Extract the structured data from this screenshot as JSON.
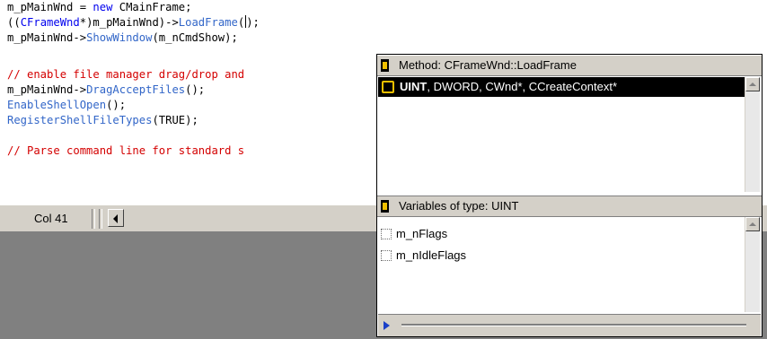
{
  "editor": {
    "lines": [
      {
        "parts": [
          {
            "t": "m_pMainWnd = ",
            "c": "plain"
          },
          {
            "t": "new",
            "c": "kw"
          },
          {
            "t": " CMainFrame;",
            "c": "plain"
          }
        ]
      },
      {
        "parts": [
          {
            "t": "((",
            "c": "plain"
          },
          {
            "t": "CFrameWnd",
            "c": "kw"
          },
          {
            "t": "*)m_pMainWnd)->",
            "c": "plain"
          },
          {
            "t": "LoadFrame",
            "c": "fn"
          },
          {
            "t": "(",
            "c": "plain"
          },
          {
            "t": "CARET",
            "c": "caret"
          },
          {
            "t": ");",
            "c": "plain"
          }
        ]
      },
      {
        "parts": [
          {
            "t": "m_pMainWnd->",
            "c": "plain"
          },
          {
            "t": "ShowWindow",
            "c": "fn"
          },
          {
            "t": "(m_nCmdShow);",
            "c": "plain"
          }
        ]
      },
      {
        "parts": [
          {
            "t": "",
            "c": "plain"
          }
        ]
      },
      {
        "parts": [
          {
            "t": "// enable file manager drag/drop and",
            "c": "cm"
          }
        ]
      },
      {
        "parts": [
          {
            "t": "m_pMainWnd->",
            "c": "plain"
          },
          {
            "t": "DragAcceptFiles",
            "c": "fn"
          },
          {
            "t": "();",
            "c": "plain"
          }
        ]
      },
      {
        "parts": [
          {
            "t": "EnableShellOpen",
            "c": "fn"
          },
          {
            "t": "();",
            "c": "plain"
          }
        ]
      },
      {
        "parts": [
          {
            "t": "RegisterShellFileTypes",
            "c": "fn"
          },
          {
            "t": "(TRUE);",
            "c": "plain"
          }
        ]
      },
      {
        "parts": [
          {
            "t": "",
            "c": "plain"
          }
        ]
      },
      {
        "parts": [
          {
            "t": "// Parse command line for standard s",
            "c": "cm"
          }
        ]
      }
    ]
  },
  "statusbar": {
    "col": "Col 41"
  },
  "popup": {
    "method_title": "Method: CFrameWnd::LoadFrame",
    "signature_bold": "UINT",
    "signature_rest": ", DWORD, CWnd*, CCreateContext*",
    "variables_title": "Variables of type: UINT",
    "variables": [
      "m_nFlags",
      "m_nIdleFlags"
    ]
  },
  "colors": {
    "keyword": "#0000ee",
    "function": "#3266c8",
    "comment": "#d40000",
    "selection": "#000000",
    "panel": "#d4d0c8",
    "gray": "#808080"
  },
  "icons": {
    "method": "method-icon",
    "signature": "signature-icon",
    "variable": "variable-icon"
  }
}
